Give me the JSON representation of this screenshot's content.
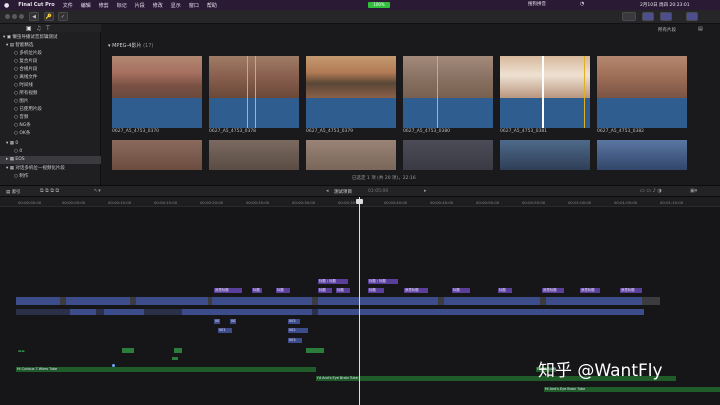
{
  "menubar": {
    "apple": "",
    "app_name": "Final Cut Pro",
    "items": [
      "文件",
      "编辑",
      "修剪",
      "标记",
      "片段",
      "修改",
      "显示",
      "窗口",
      "帮助"
    ],
    "status_battery": "100%",
    "status_input": "搜狗拼音",
    "datetime": "2月10日 周四 20:23:01"
  },
  "toolbar": {
    "buttons": [
      "◀",
      "▶",
      "✓",
      "🔑",
      "✓"
    ],
    "right_label": "所有片段"
  },
  "sidebar": {
    "library": "懒虫导播试音剪辑测试",
    "smart_collections": "智能精选",
    "smart_items": [
      "多机位片段",
      "复合片段",
      "合规片段",
      "离线文件",
      "时间线",
      "所有视频",
      "图片",
      "已使用片段",
      "音频",
      "NG条",
      "OK条"
    ],
    "event_0": "0",
    "event_0_child": "0",
    "event_eos": "EOS",
    "event_multicam": "对话多机位—视频化片段",
    "event_multicam_child": "制作"
  },
  "browser": {
    "section_title": "MPEG-4影片",
    "section_count": "(17)",
    "clips": [
      {
        "name": "0627_A5_4753_0370"
      },
      {
        "name": "0627_A5_4753_0378"
      },
      {
        "name": "0627_A5_4753_0379"
      },
      {
        "name": "0627_A5_4753_0380"
      },
      {
        "name": "0627_A5_4753_0381"
      },
      {
        "name": "0627_A5_4753_0382"
      }
    ],
    "selection_status": "已选定 1 项 (共 20 项)，22:16"
  },
  "timeline_bar": {
    "index_label": "索引",
    "project_name": "测试项目",
    "timecode": "01:05:00"
  },
  "ruler": {
    "ticks": [
      "00:00:00:00",
      "00:00:05:00",
      "00:00:10:00",
      "00:00:15:00",
      "00:00:20:00",
      "00:00:25:00",
      "00:00:30:00",
      "00:00:35:00",
      "00:00:40:00",
      "00:00:45:00",
      "00:00:50:00",
      "00:00:55:00",
      "00:01:00:00",
      "00:01:05:00",
      "00:01:10:00"
    ]
  },
  "tracks": {
    "title_row": [
      "我是标题",
      "我是标题",
      "我是标题",
      "我是标题",
      "我是标题"
    ],
    "title_row2": [
      "标题 / 标题",
      "标题",
      "标题",
      "标题",
      "标题 / 标题",
      "标题",
      "标题",
      "标题",
      "标题"
    ],
    "small_labels": [
      "001",
      "002",
      "003"
    ],
    "audio_green": [
      "Hi Curious 7 Wires Tube",
      "I'd And's Eye Brain Tube",
      "Flight Audio",
      "Hi And's Eye Brain Tube"
    ],
    "subclip": [
      "001",
      "002",
      "003"
    ]
  },
  "watermark": "知乎 @WantFly"
}
